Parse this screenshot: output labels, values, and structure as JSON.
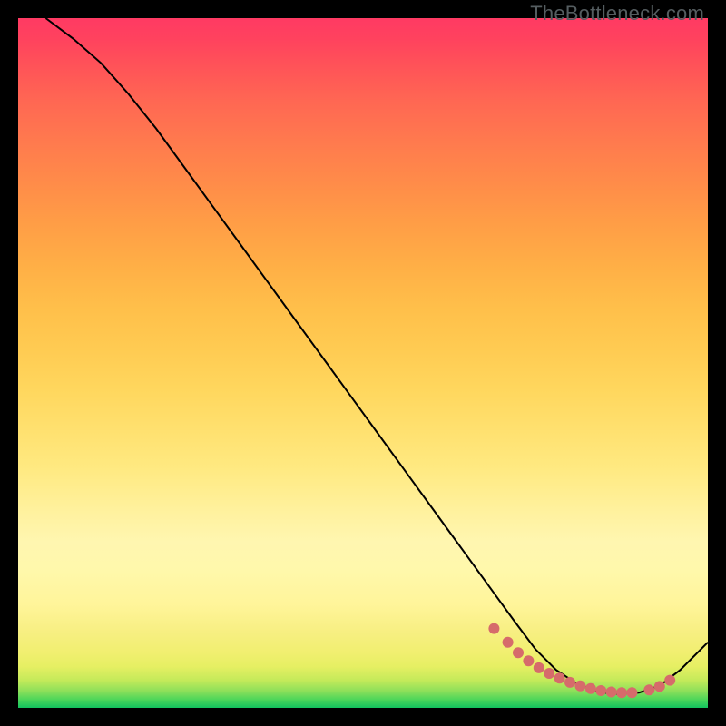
{
  "watermark": "TheBottleneck.com",
  "colors": {
    "page_bg": "#000000",
    "curve": "#000000",
    "marker": "#d66b6b",
    "gradient_top": "#ff3a63",
    "gradient_bottom": "#12c25e"
  },
  "chart_data": {
    "type": "line",
    "title": "",
    "xlabel": "",
    "ylabel": "",
    "xlim": [
      0,
      100
    ],
    "ylim": [
      0,
      100
    ],
    "series": [
      {
        "name": "curve",
        "x": [
          4,
          8,
          12,
          16,
          20,
          24,
          28,
          32,
          36,
          40,
          44,
          48,
          52,
          56,
          60,
          64,
          68,
          72,
          75,
          78,
          81,
          84,
          87,
          90,
          93,
          96,
          100
        ],
        "y": [
          100,
          97,
          93.5,
          89,
          84,
          78.5,
          73,
          67.5,
          62,
          56.5,
          51,
          45.5,
          40,
          34.5,
          29,
          23.5,
          18,
          12.5,
          8.5,
          5.5,
          3.5,
          2.3,
          2.0,
          2.2,
          3.2,
          5.5,
          9.5
        ]
      }
    ],
    "markers": {
      "x": [
        69,
        71,
        72.5,
        74,
        75.5,
        77,
        78.5,
        80,
        81.5,
        83,
        84.5,
        86,
        87.5,
        89,
        91.5,
        93,
        94.5
      ],
      "y": [
        11.5,
        9.5,
        8,
        6.8,
        5.8,
        5,
        4.3,
        3.7,
        3.2,
        2.8,
        2.5,
        2.3,
        2.2,
        2.2,
        2.6,
        3.1,
        4
      ]
    }
  }
}
